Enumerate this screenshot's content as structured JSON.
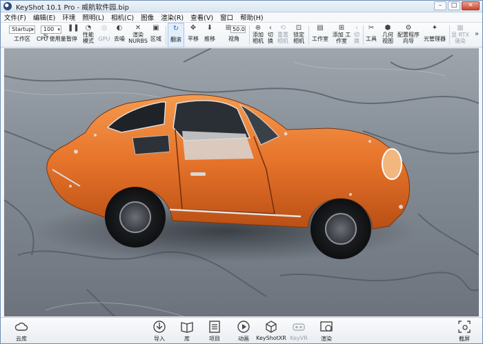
{
  "window": {
    "title": "KeyShot 10.1 Pro  - 威航软件园.bip",
    "buttons": [
      "–",
      "□",
      "✕"
    ]
  },
  "menu": [
    "文件(F)",
    "编辑(E)",
    "环境",
    "照明(L)",
    "相机(C)",
    "图像",
    "渲染(R)",
    "查看(V)",
    "窗口",
    "帮助(H)"
  ],
  "toolbar": {
    "workspace_combo": "Startup",
    "zoom_combo": "100 %",
    "fov_value": "50.0",
    "items": {
      "workspace": "工作区",
      "cpu": "CPU 使用量",
      "pause": "暂停",
      "perf": "性能 模式",
      "gpu": "GPU",
      "denoise": "去噪",
      "nurbs": "渲染 NURBS",
      "region": "区域",
      "tumble": "翻滚",
      "pan": "平移",
      "dolly": "推移",
      "fov": "视角",
      "add_camera": "添加 相机",
      "switch": "切 换",
      "reset_camera": "重置 相机",
      "lock_camera": "锁定 相机",
      "studio": "工作室",
      "add_studio": "添加 工作室",
      "switch2": "切 换",
      "tools": "工具",
      "geometry": "几何 视图",
      "config_wizard": "配置程序 向导",
      "light_manager": "光管理器",
      "rtx": "显 RTX 谐染"
    }
  },
  "bottom": {
    "cloud": "云库",
    "import": "导入",
    "library": "库",
    "project": "项目",
    "animation": "动画",
    "keyshotxr": "KeyShotXR",
    "keyvr": "KeyVR",
    "render": "渲染",
    "screenshot": "截屏"
  },
  "colors": {
    "accent": "#1a72d0",
    "car_body": "#e6732a",
    "ground": "#8a939c"
  }
}
